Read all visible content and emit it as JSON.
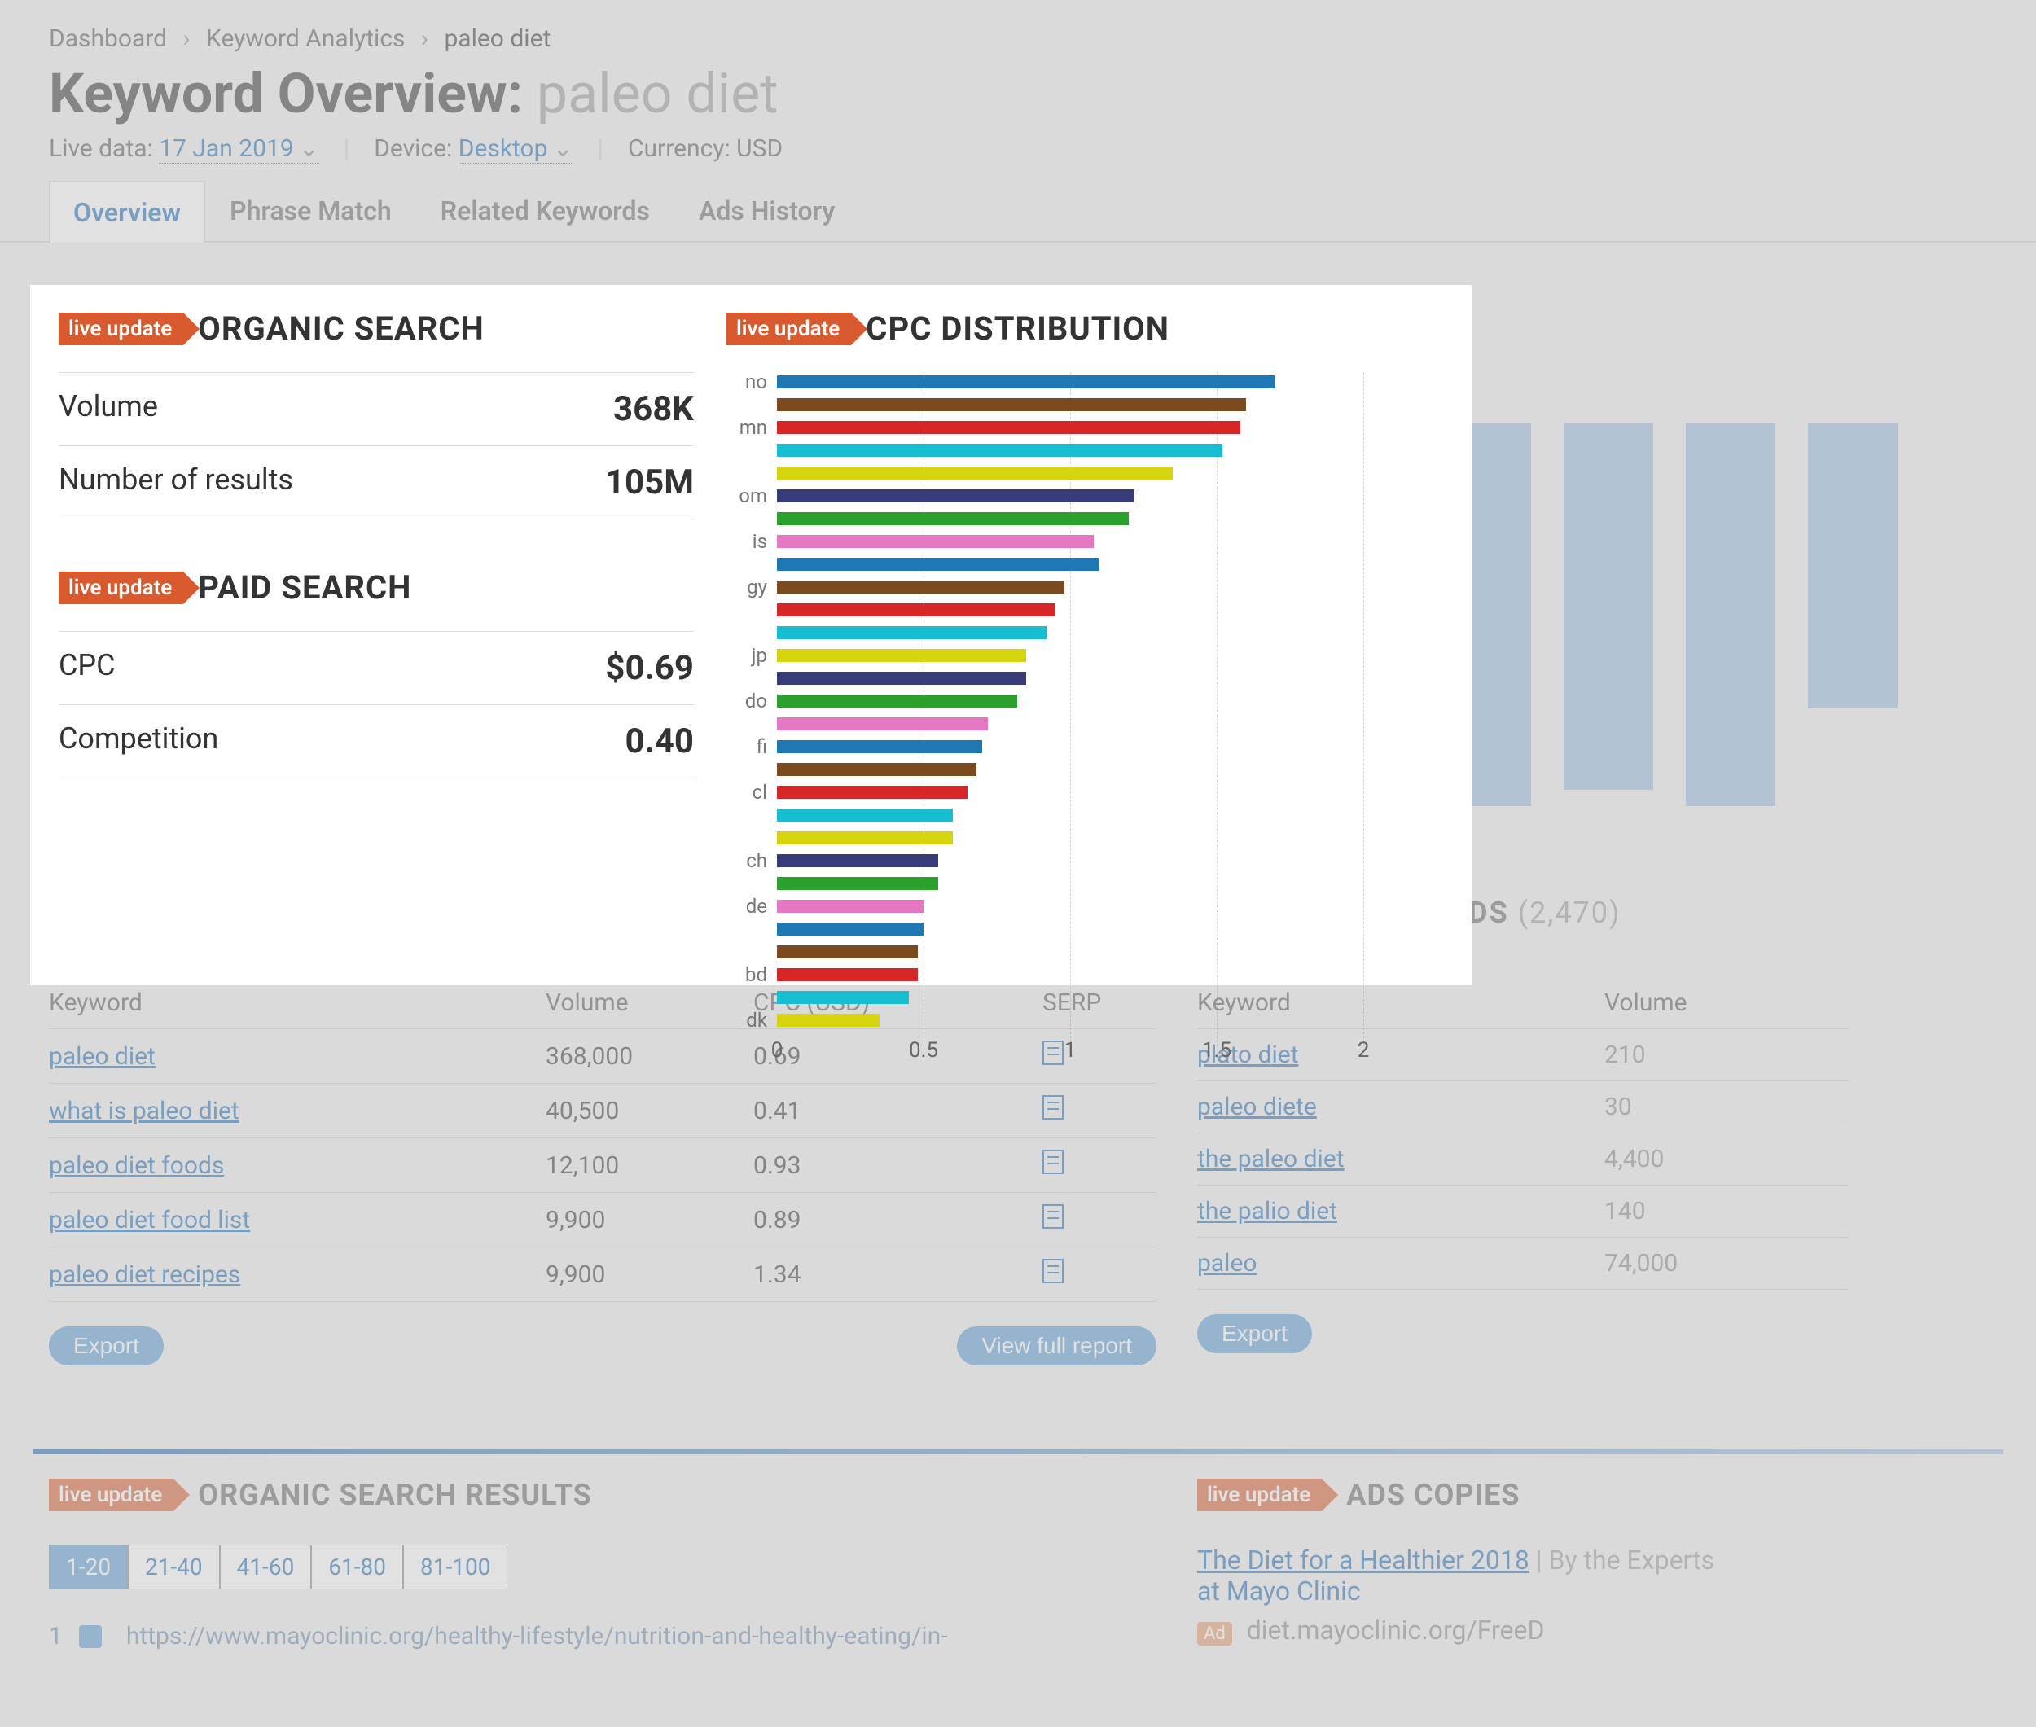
{
  "breadcrumb": {
    "items": [
      "Dashboard",
      "Keyword Analytics",
      "paleo diet"
    ]
  },
  "title": {
    "prefix": "Keyword Overview: ",
    "keyword": "paleo diet"
  },
  "metabar": {
    "live_label": "Live data:",
    "date": "17 Jan 2019",
    "device_label": "Device:",
    "device": "Desktop",
    "currency_label": "Currency: USD"
  },
  "tabs": [
    "Overview",
    "Phrase Match",
    "Related Keywords",
    "Ads History"
  ],
  "badge": "live update",
  "organic": {
    "title": "ORGANIC SEARCH",
    "volume_label": "Volume",
    "volume": "368K",
    "results_label": "Number of results",
    "results": "105M"
  },
  "paid": {
    "title": "PAID SEARCH",
    "cpc_label": "CPC",
    "cpc": "$0.69",
    "comp_label": "Competition",
    "comp": "0.40"
  },
  "cpc_dist": {
    "title": "CPC DISTRIBUTION"
  },
  "chart_data": {
    "type": "bar",
    "orientation": "horizontal",
    "title": "CPC DISTRIBUTION",
    "xlabel": "",
    "ylabel": "",
    "xlim": [
      0,
      2
    ],
    "x_ticks": [
      0,
      0.5,
      1,
      1.5,
      2
    ],
    "categories": [
      "no",
      "",
      "mn",
      "",
      "",
      "om",
      "",
      "is",
      "",
      "gy",
      "",
      "",
      "jp",
      "",
      "do",
      "",
      "fi",
      "",
      "cl",
      "",
      "",
      "ch",
      "",
      "de",
      "",
      "",
      "bd",
      "",
      "dk"
    ],
    "values": [
      1.7,
      1.6,
      1.58,
      1.52,
      1.35,
      1.22,
      1.2,
      1.08,
      1.1,
      0.98,
      0.95,
      0.92,
      0.85,
      0.85,
      0.82,
      0.72,
      0.7,
      0.68,
      0.65,
      0.6,
      0.6,
      0.55,
      0.55,
      0.5,
      0.5,
      0.48,
      0.48,
      0.45,
      0.35
    ],
    "colors": [
      "#1f77b4",
      "#7a4b1e",
      "#d62728",
      "#17becf",
      "#d6d30f",
      "#393b79",
      "#2ca02c",
      "#e377c2",
      "#1f77b4",
      "#7a4b1e",
      "#d62728",
      "#17becf",
      "#d6d30f",
      "#393b79",
      "#2ca02c",
      "#e377c2",
      "#1f77b4",
      "#7a4b1e",
      "#d62728",
      "#17becf",
      "#d6d30f",
      "#393b79",
      "#2ca02c",
      "#e377c2",
      "#1f77b4",
      "#7a4b1e",
      "#d62728",
      "#17becf",
      "#d6d30f"
    ]
  },
  "phrase_table": {
    "headers": [
      "Keyword",
      "Volume",
      "CPC (USD)",
      "SERP"
    ],
    "rows": [
      {
        "kw": "paleo diet",
        "vol": "368,000",
        "cpc": "0.69"
      },
      {
        "kw": "what is paleo diet",
        "vol": "40,500",
        "cpc": "0.41"
      },
      {
        "kw": "paleo diet foods",
        "vol": "12,100",
        "cpc": "0.93"
      },
      {
        "kw": "paleo diet food list",
        "vol": "9,900",
        "cpc": "0.89"
      },
      {
        "kw": "paleo diet recipes",
        "vol": "9,900",
        "cpc": "1.34"
      }
    ],
    "export": "Export",
    "view_full": "View full report"
  },
  "related_heading": {
    "label": "RELATED KEYWORDS",
    "count": "(2,470)"
  },
  "related_table": {
    "headers": [
      "Keyword",
      "Volume"
    ],
    "rows": [
      {
        "kw": "plato diet",
        "vol": "210"
      },
      {
        "kw": "paleo diete",
        "vol": "30"
      },
      {
        "kw": "the paleo diet",
        "vol": "4,400"
      },
      {
        "kw": "the palio diet",
        "vol": "140"
      },
      {
        "kw": "paleo",
        "vol": "74,000"
      }
    ],
    "export": "Export"
  },
  "organic_results": {
    "title": "ORGANIC SEARCH RESULTS",
    "pages": [
      "1-20",
      "21-40",
      "41-60",
      "61-80",
      "81-100"
    ],
    "first_row": {
      "num": "1",
      "url": "https://www.mayoclinic.org/healthy-lifestyle/nutrition-and-healthy-eating/in-"
    }
  },
  "ads": {
    "title": "ADS COPIES",
    "headline": "The Diet for a Healthier 2018",
    "byline": "By the Experts",
    "sub": "at Mayo Clinic",
    "display_url": "diet.mayoclinic.org/FreeD"
  }
}
